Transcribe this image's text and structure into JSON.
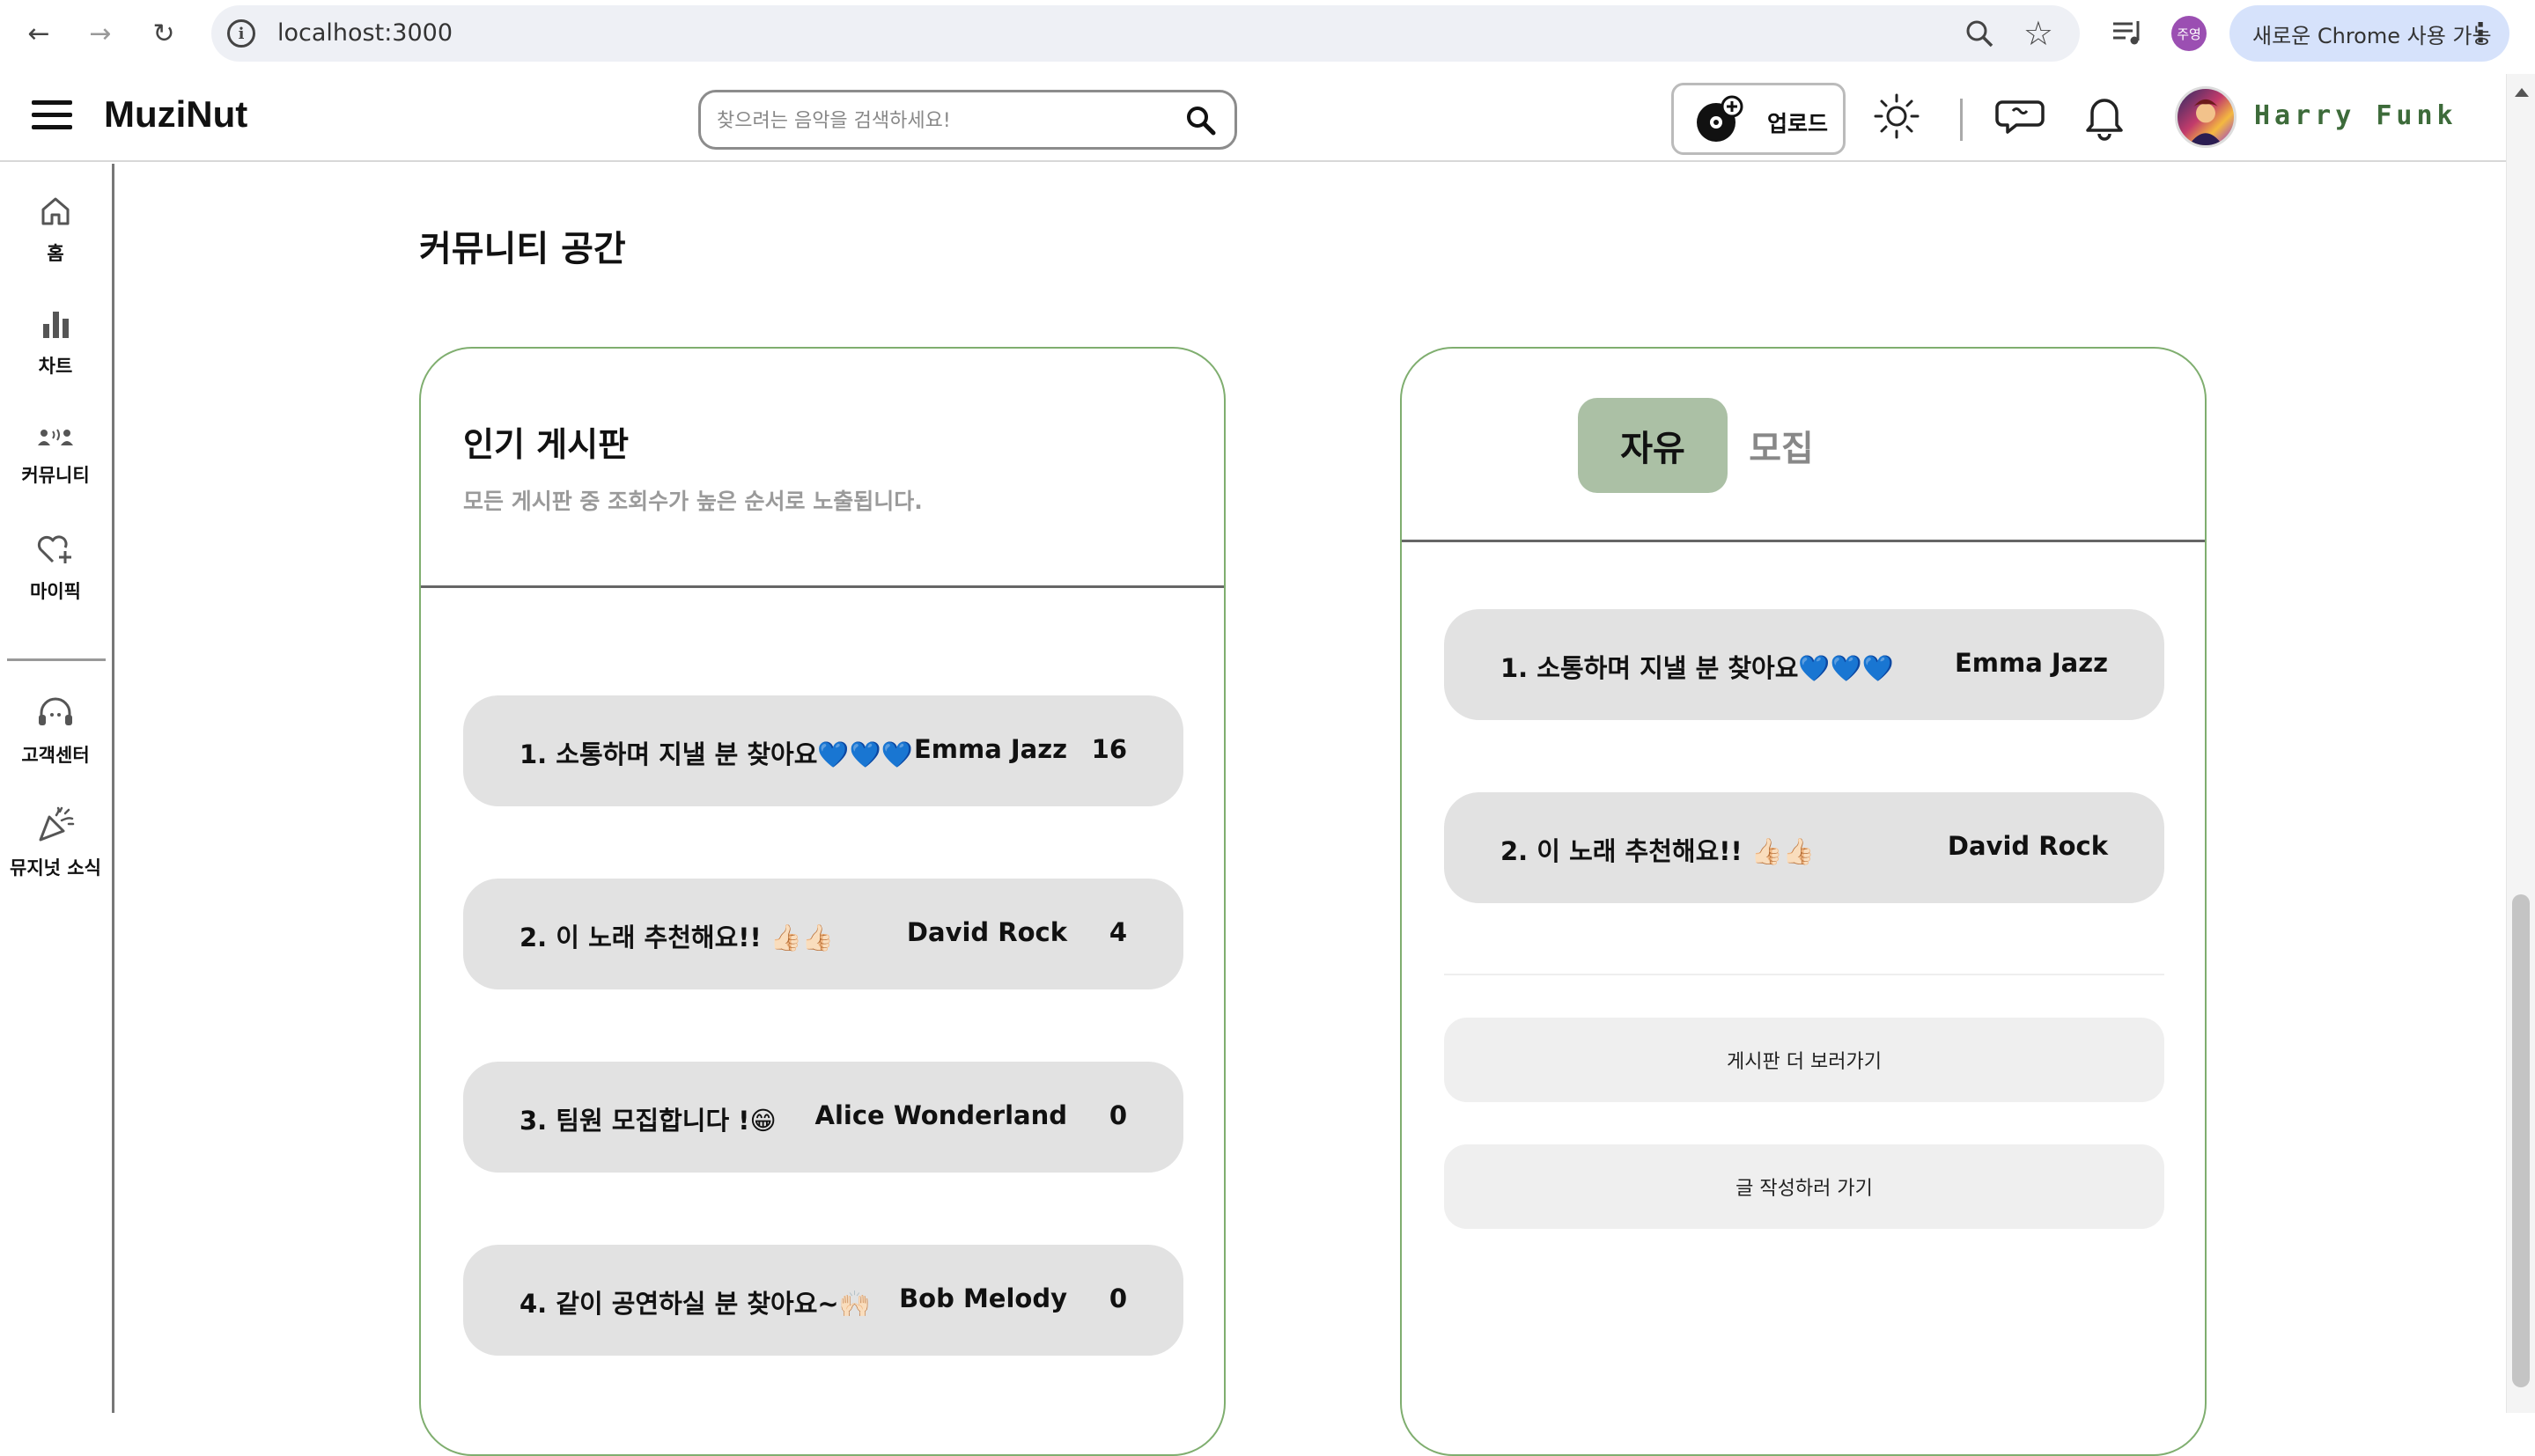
{
  "browser": {
    "url": "localhost:3000",
    "profile_initials": "주영",
    "update_label": "새로운 Chrome 사용 가능",
    "menu_glyph": "⋮",
    "back_glyph": "←",
    "forward_glyph": "→",
    "reload_glyph": "↻",
    "star_glyph": "☆",
    "info_glyph": "i"
  },
  "header": {
    "logo": "MuziNut",
    "search_placeholder": "찾으려는 음악을 검색하세요!",
    "upload_label": "업로드",
    "user_name": "Harry Funk"
  },
  "sidebar": {
    "items": [
      {
        "label": "홈",
        "icon": "home-icon"
      },
      {
        "label": "차트",
        "icon": "chart-icon"
      },
      {
        "label": "커뮤니티",
        "icon": "community-icon"
      },
      {
        "label": "마이픽",
        "icon": "heart-plus-icon"
      },
      {
        "label": "고객센터",
        "icon": "headset-icon"
      },
      {
        "label": "뮤지넛 소식",
        "icon": "party-icon"
      }
    ]
  },
  "page": {
    "title": "커뮤니티 공간"
  },
  "popular": {
    "title": "인기 게시판",
    "subtitle": "모든 게시판 중 조회수가 높은 순서로 노출됩니다.",
    "posts": [
      {
        "title": "1. 소통하며 지낼 분 찾아요💙💙💙",
        "author": "Emma Jazz",
        "count": "16"
      },
      {
        "title": "2. 이 노래 추천해요!! 👍🏻👍🏻",
        "author": "David Rock",
        "count": "4"
      },
      {
        "title": "3. 팀원 모집합니다 !😁",
        "author": "Alice Wonderland",
        "count": "0"
      },
      {
        "title": "4. 같이 공연하실 분 찾아요~🙌🏻",
        "author": "Bob Melody",
        "count": "0"
      }
    ]
  },
  "board": {
    "tabs": [
      {
        "label": "자유",
        "active": true
      },
      {
        "label": "모집",
        "active": false
      }
    ],
    "posts": [
      {
        "title": "1. 소통하며 지낼 분 찾아요💙💙💙",
        "author": "Emma Jazz"
      },
      {
        "title": "2. 이 노래 추천해요!! 👍🏻👍🏻",
        "author": "David Rock"
      }
    ],
    "more_label": "게시판 더 보러가기",
    "write_label": "글 작성하러 가기"
  },
  "colors": {
    "card_border": "#7fae6f",
    "active_tab": "#abc0a5",
    "user_name": "#3d6b3a",
    "row_bg": "#e2e2e2"
  }
}
